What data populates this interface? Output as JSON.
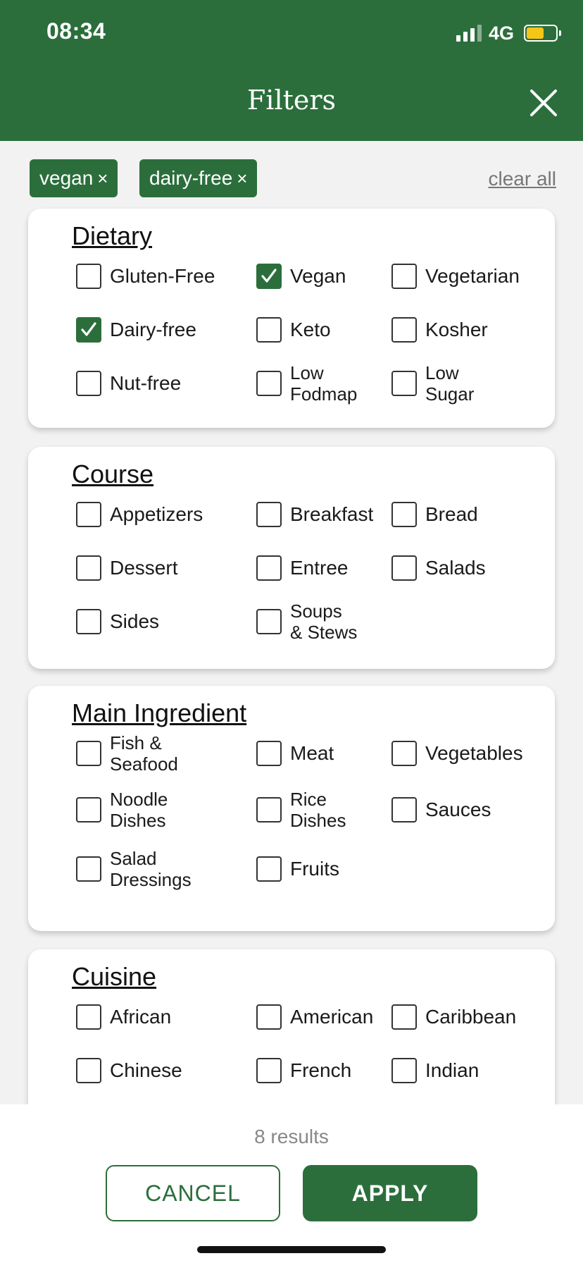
{
  "status_bar": {
    "time": "08:34",
    "network": "4G"
  },
  "header": {
    "title": "Filters"
  },
  "active_filters": {
    "chips": [
      {
        "label": "vegan",
        "remove": "×"
      },
      {
        "label": "dairy-free",
        "remove": "×"
      }
    ],
    "clear_all": "clear all"
  },
  "sections": [
    {
      "title": "Dietary",
      "options": [
        {
          "label": "Gluten-Free",
          "checked": false
        },
        {
          "label": "Vegan",
          "checked": true
        },
        {
          "label": "Vegetarian",
          "checked": false
        },
        {
          "label": "Dairy-free",
          "checked": true
        },
        {
          "label": "Keto",
          "checked": false
        },
        {
          "label": "Kosher",
          "checked": false
        },
        {
          "label": "Nut-free",
          "checked": false
        },
        {
          "label": "Low\nFodmap",
          "checked": false
        },
        {
          "label": "Low\nSugar",
          "checked": false
        }
      ]
    },
    {
      "title": "Course",
      "options": [
        {
          "label": "Appetizers",
          "checked": false
        },
        {
          "label": "Breakfast",
          "checked": false
        },
        {
          "label": "Bread",
          "checked": false
        },
        {
          "label": "Dessert",
          "checked": false
        },
        {
          "label": "Entree",
          "checked": false
        },
        {
          "label": "Salads",
          "checked": false
        },
        {
          "label": "Sides",
          "checked": false
        },
        {
          "label": "Soups\n& Stews",
          "checked": false
        }
      ]
    },
    {
      "title": "Main Ingredient",
      "options": [
        {
          "label": "Fish &\nSeafood",
          "checked": false
        },
        {
          "label": "Meat",
          "checked": false
        },
        {
          "label": "Vegetables",
          "checked": false
        },
        {
          "label": "Noodle\nDishes",
          "checked": false
        },
        {
          "label": "Rice\nDishes",
          "checked": false
        },
        {
          "label": "Sauces",
          "checked": false
        },
        {
          "label": "Salad\nDressings",
          "checked": false
        },
        {
          "label": "Fruits",
          "checked": false
        }
      ]
    },
    {
      "title": "Cuisine",
      "options": [
        {
          "label": "African",
          "checked": false
        },
        {
          "label": "American",
          "checked": false
        },
        {
          "label": "Caribbean",
          "checked": false
        },
        {
          "label": "Chinese",
          "checked": false
        },
        {
          "label": "French",
          "checked": false
        },
        {
          "label": "Indian",
          "checked": false
        }
      ]
    }
  ],
  "footer": {
    "results": "8 results",
    "cancel": "CANCEL",
    "apply": "APPLY"
  },
  "colors": {
    "primary": "#2b6e3c",
    "background": "#f2f2f2",
    "battery": "#f5c518"
  },
  "icons": {
    "close": "close-icon",
    "check": "checkmark-icon",
    "signal": "signal-icon",
    "battery": "battery-icon"
  }
}
